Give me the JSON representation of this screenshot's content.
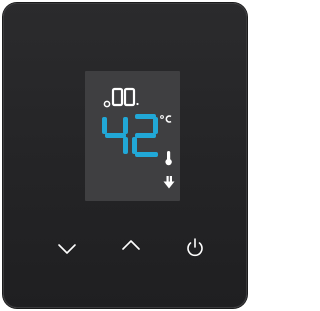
{
  "device": {
    "accent_color": "#21a8d7",
    "panel_color": "#252527",
    "display_color": "#3f3f41"
  },
  "display": {
    "top_readout": ".00.",
    "temperature": "42",
    "unit": "°C",
    "thermometer_icon": "thermometer-icon",
    "status_icon": "heating-down-arrow-icon"
  },
  "controls": [
    {
      "name": "down-button",
      "icon": "chevron-down-icon"
    },
    {
      "name": "up-button",
      "icon": "chevron-up-icon"
    },
    {
      "name": "power-button",
      "icon": "power-icon"
    }
  ]
}
